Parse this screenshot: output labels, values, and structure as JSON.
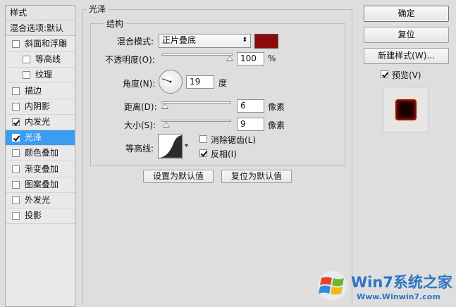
{
  "sidebar": {
    "header": "样式",
    "blend_options": "混合选项:默认",
    "items": [
      {
        "label": "斜面和浮雕",
        "checked": false,
        "indent": false,
        "selected": false
      },
      {
        "label": "等高线",
        "checked": false,
        "indent": true,
        "selected": false
      },
      {
        "label": "纹理",
        "checked": false,
        "indent": true,
        "selected": false
      },
      {
        "label": "描边",
        "checked": false,
        "indent": false,
        "selected": false
      },
      {
        "label": "内阴影",
        "checked": false,
        "indent": false,
        "selected": false
      },
      {
        "label": "内发光",
        "checked": true,
        "indent": false,
        "selected": false
      },
      {
        "label": "光泽",
        "checked": true,
        "indent": false,
        "selected": true
      },
      {
        "label": "颜色叠加",
        "checked": false,
        "indent": false,
        "selected": false
      },
      {
        "label": "渐变叠加",
        "checked": false,
        "indent": false,
        "selected": false
      },
      {
        "label": "图案叠加",
        "checked": false,
        "indent": false,
        "selected": false
      },
      {
        "label": "外发光",
        "checked": false,
        "indent": false,
        "selected": false
      },
      {
        "label": "投影",
        "checked": false,
        "indent": false,
        "selected": false
      }
    ]
  },
  "panel": {
    "title": "光泽",
    "structure_title": "结构",
    "blend_mode_label": "混合模式:",
    "blend_mode_value": "正片叠底",
    "blend_color": "#8b0a0a",
    "opacity_label": "不透明度(O):",
    "opacity_value": "100",
    "opacity_unit": "%",
    "opacity_level": 1.0,
    "angle_label": "角度(N):",
    "angle_value": "19",
    "angle_unit": "度",
    "distance_label": "距离(D):",
    "distance_value": "6",
    "distance_unit": "像素",
    "size_label": "大小(S):",
    "size_value": "9",
    "size_unit": "像素",
    "contour_label": "等高线:",
    "antialias_label": "消除锯齿(L)",
    "antialias_checked": false,
    "invert_label": "反相(I)",
    "invert_checked": true,
    "set_default_button": "设置为默认值",
    "reset_default_button": "复位为默认值"
  },
  "actions": {
    "ok": "确定",
    "reset": "复位",
    "new_style": "新建样式(W)...",
    "preview_label": "预览(V)",
    "preview_checked": true
  },
  "watermark": {
    "brand": "Win7系统之家",
    "url": "Www.Winwin7.com"
  }
}
